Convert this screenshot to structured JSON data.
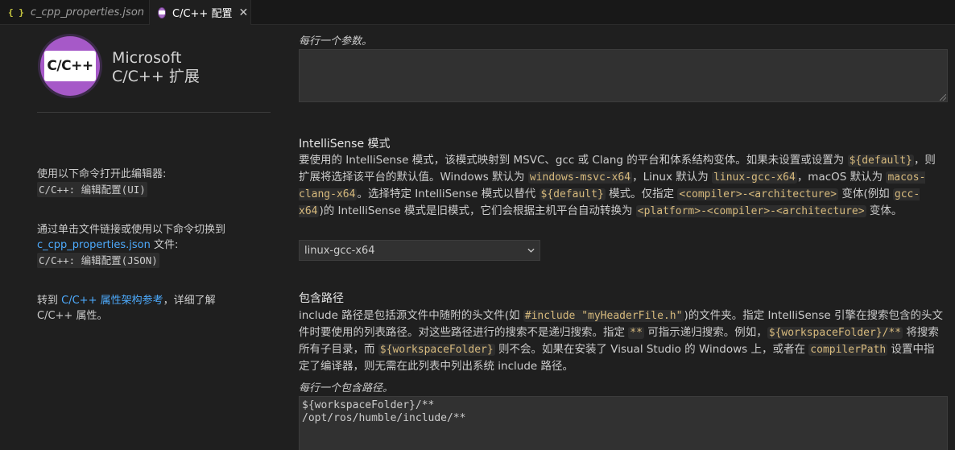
{
  "tabs": [
    {
      "icon": "json-icon",
      "label": "c_cpp_properties.json"
    },
    {
      "icon": "cpp-icon",
      "label": "C/C++ 配置"
    }
  ],
  "sidebar": {
    "logo_text": "C/C++",
    "brand_line1": "Microsoft",
    "brand_line2": "C/C++ 扩展",
    "open_editor_text": "使用以下命令打开此编辑器:",
    "open_editor_cmd": "C/C++: 编辑配置(UI)",
    "switch_text1": "通过单击文件链接或使用以下命令切换到",
    "switch_link": "c_cpp_properties.json",
    "switch_text2": " 文件:",
    "switch_cmd": "C/C++: 编辑配置(JSON)",
    "ref_text1": "转到 ",
    "ref_link": "C/C++ 属性架构参考",
    "ref_text2": "，详细了解 C/C++ 属性。"
  },
  "args_section": {
    "hint": "每行一个参数。",
    "value": ""
  },
  "intellisense": {
    "heading": "IntelliSense 模式",
    "d1": "要使用的 IntelliSense 模式，该模式映射到 MSVC、gcc 或 Clang 的平台和体系结构变体。如果未设置或设置为 ",
    "c1": "${default}",
    "d2": "，则扩展将选择该平台的默认值。Windows 默认为 ",
    "c2": "windows-msvc-x64",
    "d3": "，Linux 默认为 ",
    "c3": "linux-gcc-x64",
    "d4": "，macOS 默认为 ",
    "c4": "macos-clang-x64",
    "d5": "。选择特定 IntelliSense 模式以替代 ",
    "c5": "${default}",
    "d6": " 模式。仅指定 ",
    "c6": "<compiler>-<architecture>",
    "d7": " 变体(例如 ",
    "c7": "gcc-x64",
    "d8": ")的 IntelliSense 模式是旧模式，它们会根据主机平台自动转换为 ",
    "c8": "<platform>-<compiler>-<architecture>",
    "d9": " 变体。",
    "selected": "linux-gcc-x64"
  },
  "include_path": {
    "heading": "包含路径",
    "d1": "include 路径是包括源文件中随附的头文件(如 ",
    "c1": "#include \"myHeaderFile.h\"",
    "d2": ")的文件夹。指定 IntelliSense 引擎在搜索包含的头文件时要使用的列表路径。对这些路径进行的搜索不是递归搜索。指定 ",
    "c2": "**",
    "d3": " 可指示递归搜索。例如，",
    "c3": "${workspaceFolder}/**",
    "d4": " 将搜索所有子目录，而 ",
    "c4": "${workspaceFolder}",
    "d5": " 则不会。如果在安装了 Visual Studio 的 Windows 上，或者在 ",
    "c5": "compilerPath",
    "d6": " 设置中指定了编译器，则无需在此列表中列出系统 include 路径。",
    "hint": "每行一个包含路径。",
    "lines": [
      "${workspaceFolder}/**",
      "/opt/ros/humble/include/**"
    ]
  }
}
